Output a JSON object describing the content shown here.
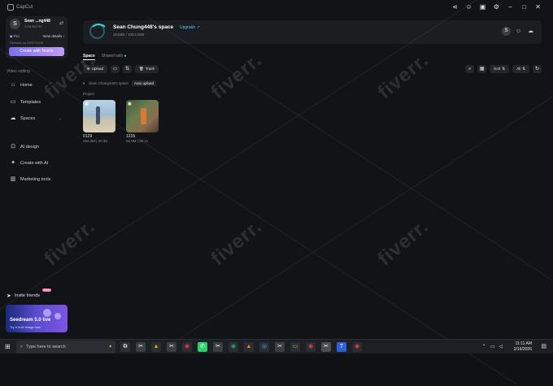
{
  "app": {
    "brand": "CapCut"
  },
  "titlebar_icons": [
    "share-icon",
    "user-icon",
    "gift-icon",
    "settings-icon"
  ],
  "profile": {
    "avatar_letter": "S",
    "name": "Sean ...ng448",
    "id": "2191342767",
    "plan": "Pro",
    "view_details": "View details",
    "renews": "Renews on 02/07/2026",
    "teams_button": "Create with Teams"
  },
  "sidebar": {
    "section": "Video editing",
    "items": [
      {
        "label": "Home",
        "icon": "home-icon"
      },
      {
        "label": "Templates",
        "icon": "templates-icon"
      },
      {
        "label": "Spaces",
        "icon": "spaces-icon"
      },
      {
        "label": "AI design",
        "icon": "ai-design-icon"
      },
      {
        "label": "Create with AI",
        "icon": "create-ai-icon"
      },
      {
        "label": "Marketing tools",
        "icon": "marketing-icon"
      }
    ],
    "invite": "Invite friends",
    "new_badge": "New",
    "promo_title": "Seedream 5.0 live",
    "promo_sub": "Try it in AI image now"
  },
  "space": {
    "title": "Sean Chung448's space",
    "upgrade": "Upgrade",
    "storage": "251MB / 1024.0GB",
    "storage_fraction": 0.25,
    "avatar_letter": "S"
  },
  "tabs": {
    "active": "Space",
    "other": "Shared with"
  },
  "toolbar": {
    "upload": "Upload",
    "trash": "Trash",
    "sort": "Sort",
    "filter": "All"
  },
  "breadcrumb": {
    "space": "Sean Chung448's space",
    "auto_upload": "Auto upload"
  },
  "project_label": "Project",
  "projects": [
    {
      "name": "0129",
      "meta": "254.3M | 00:36"
    },
    {
      "name": "1215",
      "meta": "59.9M | 00:11"
    }
  ],
  "taskbar": {
    "search_placeholder": "Type here to search",
    "time": "11:11 AM",
    "date": "2/16/2026"
  },
  "watermark": "fiverr."
}
